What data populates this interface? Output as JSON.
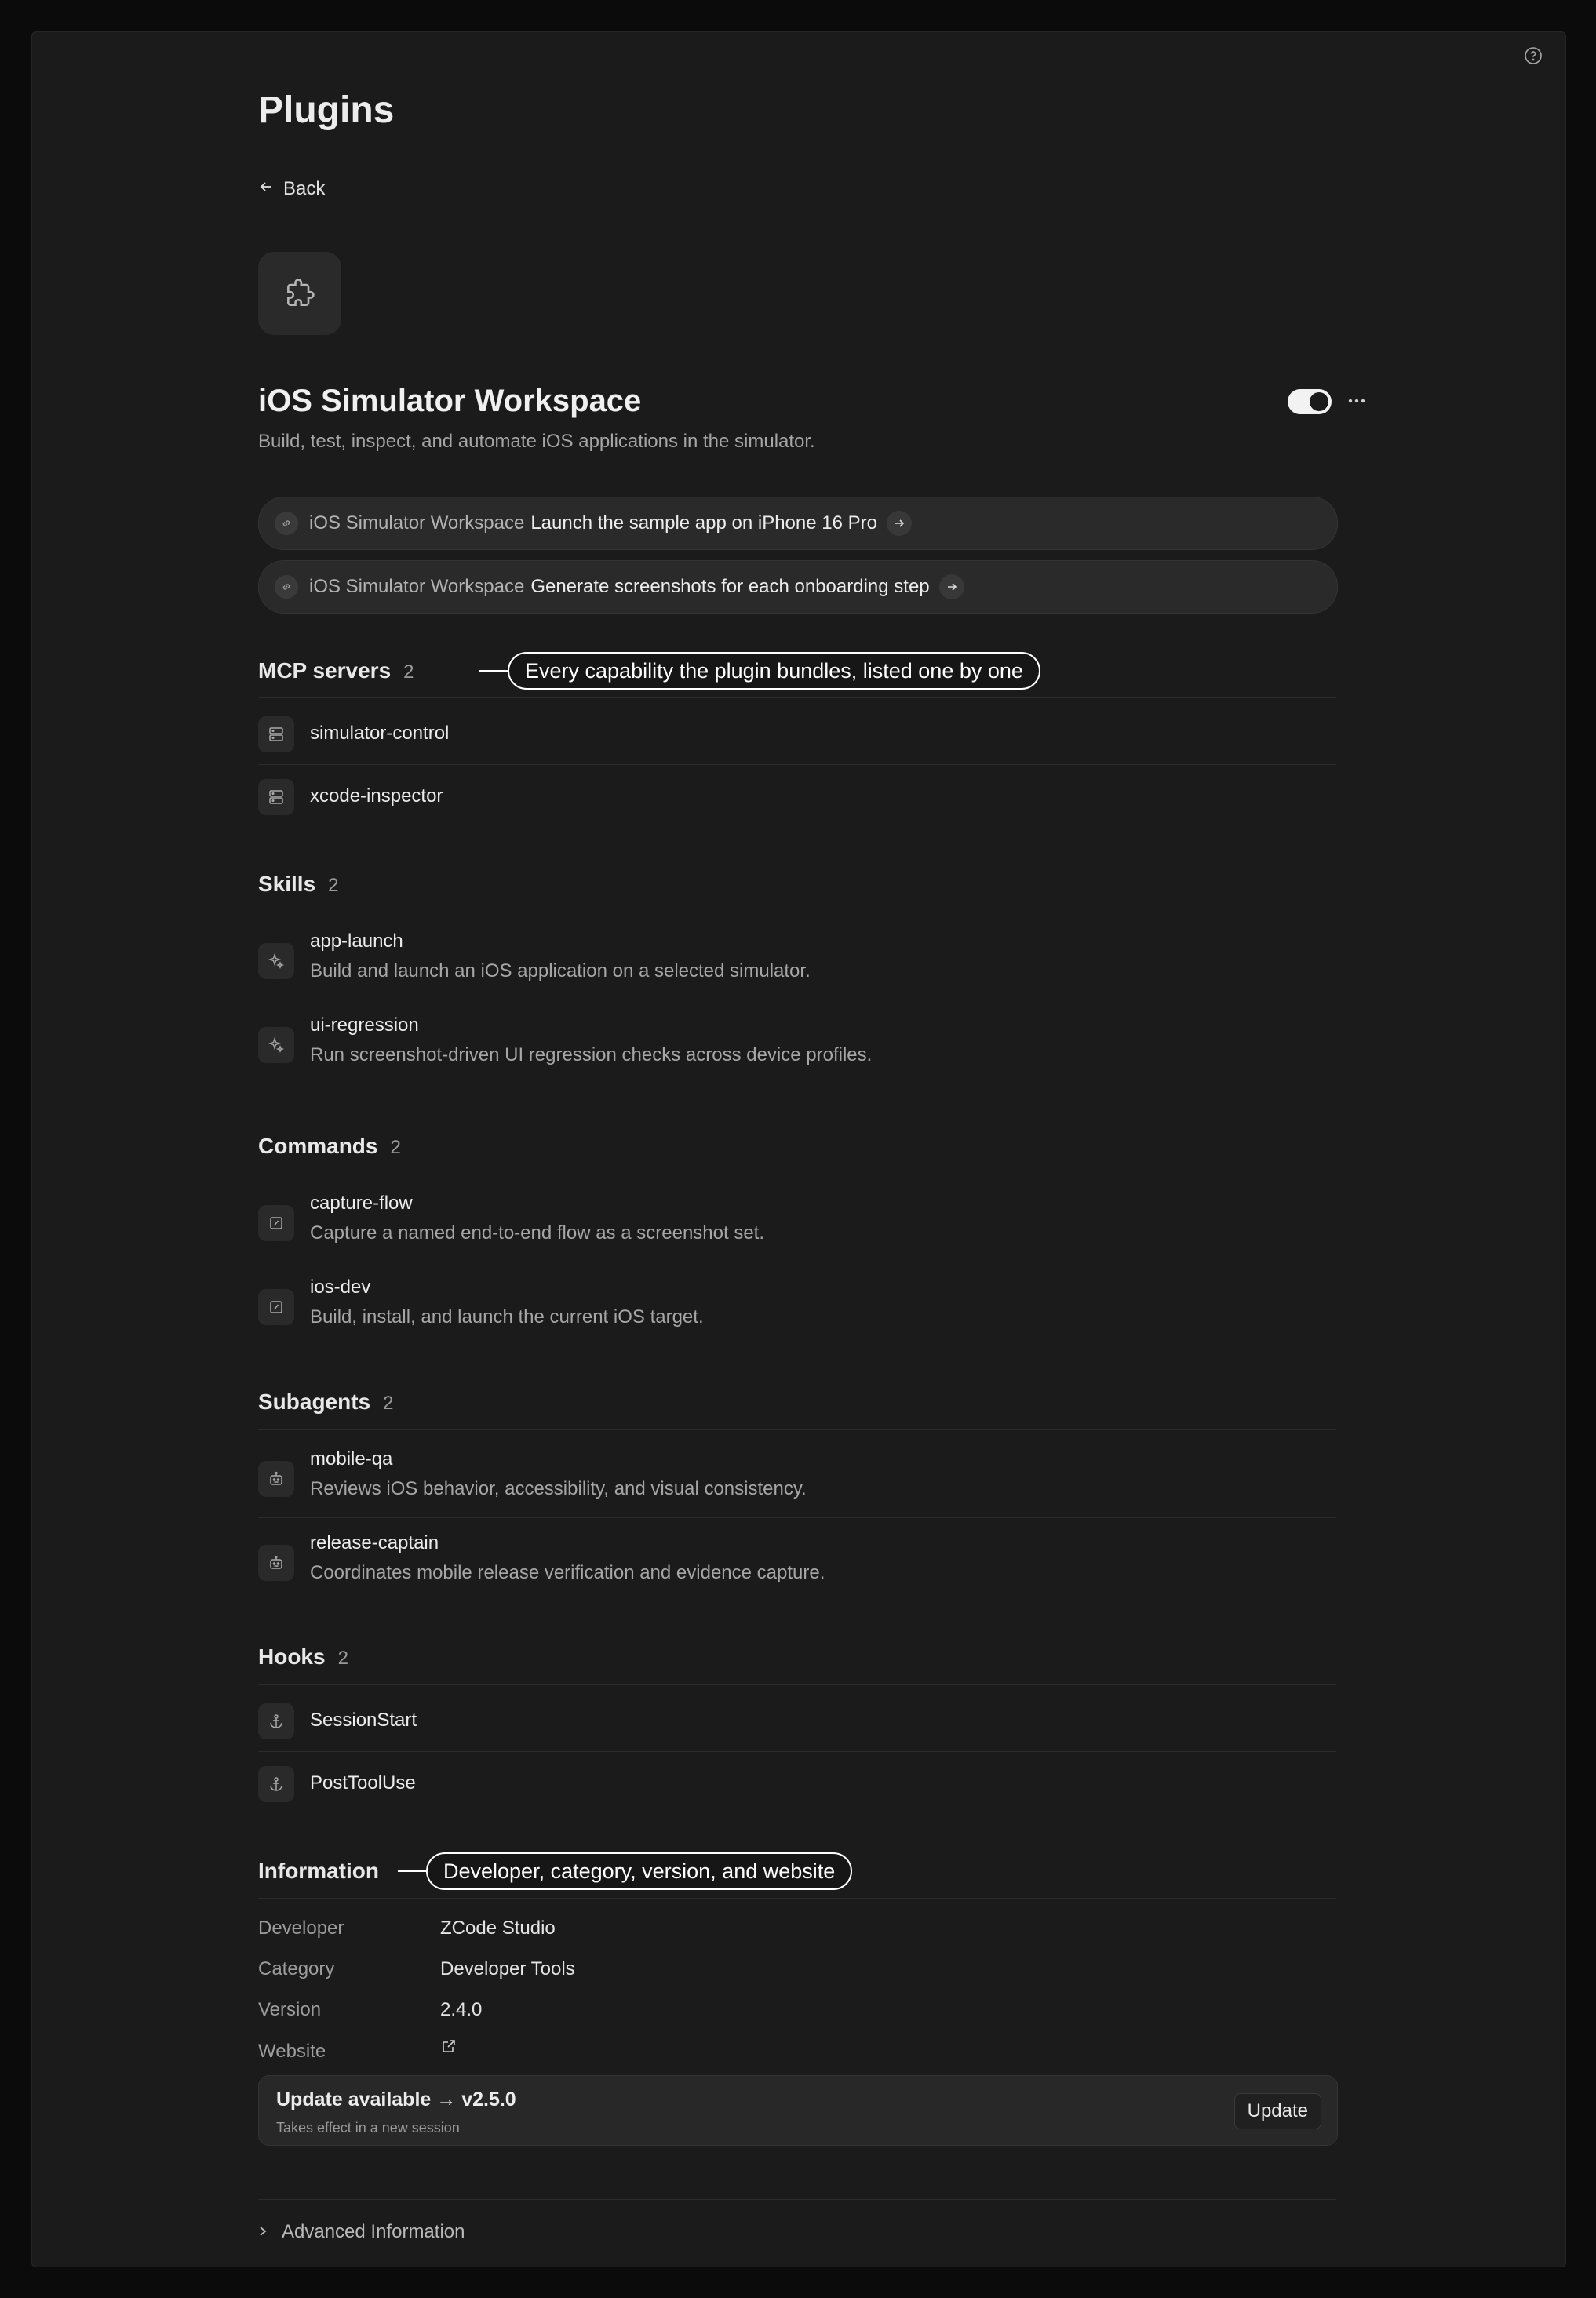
{
  "page": {
    "title": "Plugins",
    "back_label": "Back"
  },
  "plugin": {
    "name": "iOS Simulator Workspace",
    "description": "Build, test, inspect, and automate iOS applications in the simulator.",
    "enabled": true
  },
  "prompts": [
    {
      "plugin": "iOS Simulator Workspace",
      "text": "Launch the sample app on iPhone 16 Pro"
    },
    {
      "plugin": "iOS Simulator Workspace",
      "text": "Generate screenshots for each onboarding step"
    }
  ],
  "sections": {
    "mcp": {
      "title": "MCP servers",
      "count": "2",
      "items": [
        {
          "name": "simulator-control",
          "icon": "server-icon"
        },
        {
          "name": "xcode-inspector",
          "icon": "server-icon"
        }
      ]
    },
    "skills": {
      "title": "Skills",
      "count": "2",
      "items": [
        {
          "name": "app-launch",
          "desc": "Build and launch an iOS application on a selected simulator.",
          "icon": "sparkle-icon"
        },
        {
          "name": "ui-regression",
          "desc": "Run screenshot-driven UI regression checks across device profiles.",
          "icon": "sparkle-icon"
        }
      ]
    },
    "commands": {
      "title": "Commands",
      "count": "2",
      "items": [
        {
          "name": "capture-flow",
          "desc": "Capture a named end-to-end flow as a screenshot set.",
          "icon": "command-icon"
        },
        {
          "name": "ios-dev",
          "desc": "Build, install, and launch the current iOS target.",
          "icon": "command-icon"
        }
      ]
    },
    "subagents": {
      "title": "Subagents",
      "count": "2",
      "items": [
        {
          "name": "mobile-qa",
          "desc": "Reviews iOS behavior, accessibility, and visual consistency.",
          "icon": "robot-icon"
        },
        {
          "name": "release-captain",
          "desc": "Coordinates mobile release verification and evidence capture.",
          "icon": "robot-icon"
        }
      ]
    },
    "hooks": {
      "title": "Hooks",
      "count": "2",
      "items": [
        {
          "name": "SessionStart",
          "icon": "anchor-icon"
        },
        {
          "name": "PostToolUse",
          "icon": "anchor-icon"
        }
      ]
    }
  },
  "information": {
    "title": "Information",
    "developer_label": "Developer",
    "developer": "ZCode Studio",
    "category_label": "Category",
    "category": "Developer Tools",
    "version_label": "Version",
    "version": "2.4.0",
    "website_label": "Website"
  },
  "update": {
    "title": "Update available → v2.5.0",
    "subtitle": "Takes effect in a new session",
    "button": "Update"
  },
  "advanced_label": "Advanced Information",
  "callouts": {
    "capabilities": "Every capability the plugin bundles, listed one by one",
    "information": "Developer, category, version, and website"
  }
}
